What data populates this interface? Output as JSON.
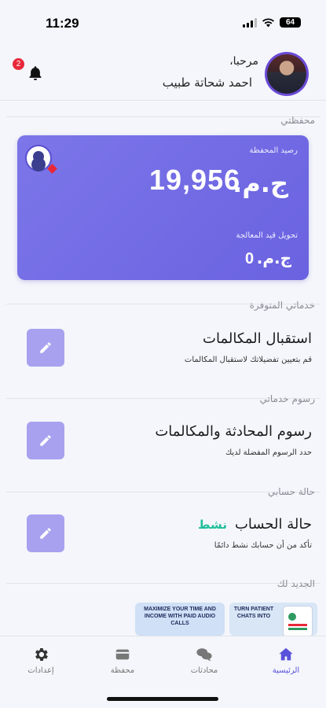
{
  "status_bar": {
    "time": "11:29",
    "battery": "64"
  },
  "header": {
    "greeting": "مرحبا،",
    "user_name": "احمد شحاتة طبيب",
    "notifications_count": "2"
  },
  "wallet": {
    "section_label": "محفظتي",
    "balance_label": "رصيد المحفظة",
    "balance_amount": "19,956",
    "balance_currency": "ج.م.",
    "pending_label": "تحويل قيد المعالجة",
    "pending_amount": "0",
    "pending_currency": "ج.م."
  },
  "services": {
    "section_label": "خدماتي المتوفرة",
    "title": "استقبال المكالمات",
    "subtitle": "قم بتعيين تفضيلاتك لاستقبال المكالمات"
  },
  "fees": {
    "section_label": "رسوم خدماتي",
    "title": "رسوم المحادثة والمكالمات",
    "subtitle": "حدد الرسوم المفضلة لديك"
  },
  "account": {
    "section_label": "حالة حسابي",
    "title": "حالة الحساب",
    "status": "نشط",
    "subtitle": "تأكد من أن حسابك نشط دائمًا"
  },
  "news": {
    "section_label": "الجديد لك",
    "banner1_text": "MAXIMIZE YOUR TIME AND INCOME WITH PAID AUDIO CALLS",
    "banner2_text": "TURN PATIENT CHATS INTO"
  },
  "tabs": [
    {
      "label": "الرئيسية",
      "icon": "home-icon"
    },
    {
      "label": "محادثات",
      "icon": "chat-icon"
    },
    {
      "label": "محفظة",
      "icon": "wallet-icon"
    },
    {
      "label": "إعدادات",
      "icon": "gear-icon"
    }
  ],
  "colors": {
    "accent": "#6a62e0",
    "active_status": "#1fbe9a",
    "badge": "#e8283a"
  }
}
